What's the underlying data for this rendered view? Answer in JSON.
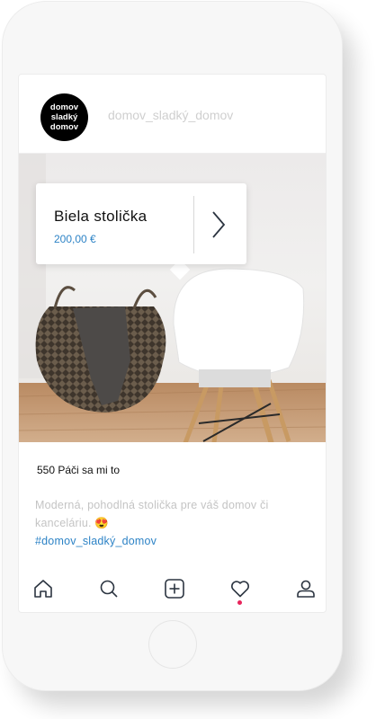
{
  "profile": {
    "avatar_lines": [
      "domov",
      "sladký",
      "domov"
    ],
    "username": "domov_sladký_domov"
  },
  "product_tag": {
    "title": "Biela stolička",
    "price": "200,00 €",
    "arrow_icon": "chevron-right-icon"
  },
  "post": {
    "likes": "550 Páči sa mi to",
    "caption": "Moderná, pohodlná stolička pre váš domov či kanceláriu.",
    "caption_emoji": "😍",
    "hashtag": "#domov_sladký_domov"
  },
  "tabbar": {
    "items": [
      "home-icon",
      "search-icon",
      "add-post-icon",
      "heart-icon",
      "profile-icon"
    ],
    "notification_color": "#e8245b"
  },
  "colors": {
    "link": "#2d83c6",
    "muted": "#c4c4c4"
  }
}
